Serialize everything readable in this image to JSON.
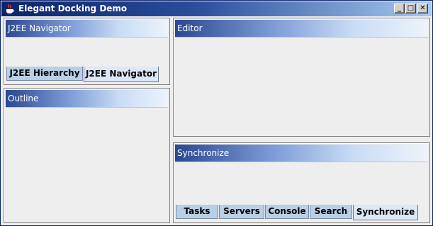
{
  "window": {
    "title": "Elegant Docking Demo"
  },
  "window_controls": {
    "minimize": "_",
    "maximize": "□",
    "close": "✕"
  },
  "panels": {
    "j2ee_navigator": {
      "title": "J2EE Navigator"
    },
    "outline": {
      "title": "Outline"
    },
    "editor": {
      "title": "Editor"
    },
    "synchronize": {
      "title": "Synchronize"
    }
  },
  "top_left_tabs": [
    {
      "label": "J2EE Hierarchy",
      "active": false
    },
    {
      "label": "J2EE Navigator",
      "active": true
    }
  ],
  "bottom_tabs": [
    {
      "label": "Tasks",
      "active": false
    },
    {
      "label": "Servers",
      "active": false
    },
    {
      "label": "Console",
      "active": false
    },
    {
      "label": "Search",
      "active": false
    },
    {
      "label": "Synchronize",
      "active": true
    }
  ],
  "colors": {
    "title_bar": "#0a246a",
    "panel_header": "#2b4891",
    "tab": "#b8cfe5",
    "active_tab": "#dde8f5"
  }
}
